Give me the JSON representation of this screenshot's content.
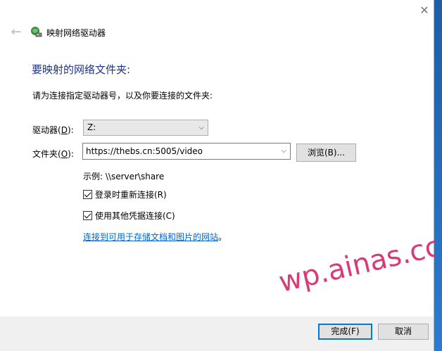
{
  "window": {
    "title": "映射网络驱动器",
    "close_glyph": "✕",
    "back_glyph": "←"
  },
  "heading": "要映射的网络文件夹:",
  "instruction": "请为连接指定驱动器号，以及你要连接的文件夹:",
  "drive": {
    "label_pre": "驱动器(",
    "label_key": "D",
    "label_post": "):",
    "value": "Z:",
    "chevron_glyph": "⌵"
  },
  "folder": {
    "label_pre": "文件夹(",
    "label_key": "O",
    "label_post": "):",
    "value": "https://thebs.cn:5005/video",
    "chevron_glyph": "⌵",
    "browse_label": "浏览(B)..."
  },
  "example": "示例: \\\\server\\share",
  "checkboxes": [
    {
      "label": "登录时重新连接(R)",
      "checked": true
    },
    {
      "label": "使用其他凭据连接(C)",
      "checked": true
    }
  ],
  "link": {
    "text": "连接到可用于存储文档和图片的网站",
    "suffix": "。"
  },
  "footer": {
    "finish_label": "完成(F)",
    "cancel_label": "取消"
  },
  "watermark": "wp.ainas.cc",
  "colors": {
    "heading": "#1e3287",
    "link": "#0066cc",
    "primary_border": "#0078d7",
    "watermark": "#d93a7a"
  }
}
